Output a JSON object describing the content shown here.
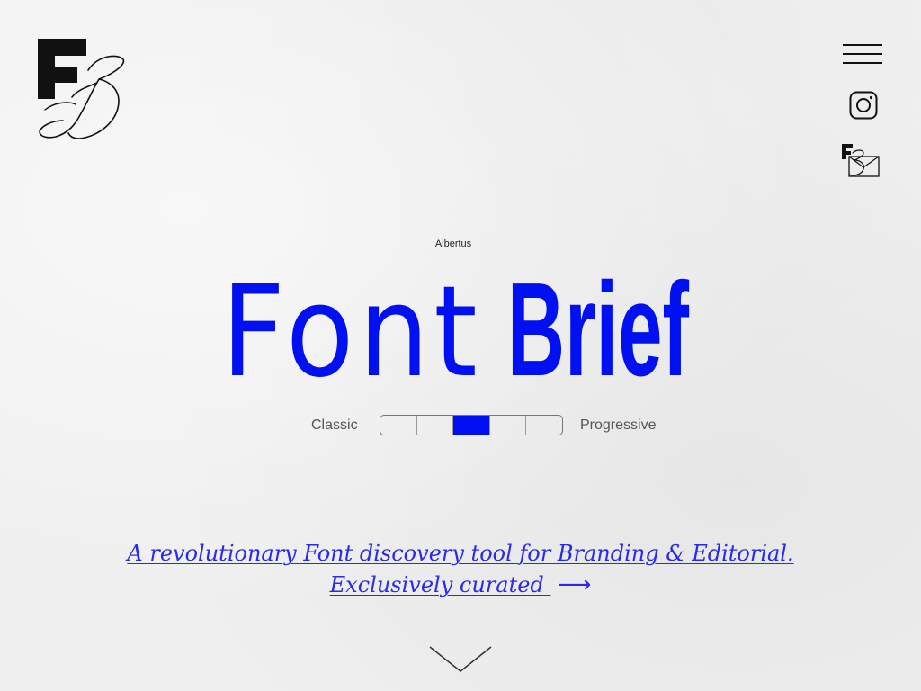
{
  "brand": {
    "logo_name": "FB-monogram-logo"
  },
  "nav": {
    "menu_icon": "hamburger-menu-icon",
    "instagram_icon": "instagram-icon",
    "contact_icon": "fb-envelope-icon"
  },
  "hero": {
    "font_caption": "Albertus",
    "title_word1": "Font",
    "title_word2": "Brief",
    "accent_color": "#0010f0"
  },
  "style_scale": {
    "left_label": "Classic",
    "right_label": "Progressive",
    "segments": 5,
    "selected_index": 2
  },
  "tagline": {
    "line1": "A revolutionary Font discovery tool for Branding & Editorial.",
    "line2": "Exclusively curated",
    "arrow": "⟶"
  },
  "scroll": {
    "icon": "chevron-down-icon"
  }
}
